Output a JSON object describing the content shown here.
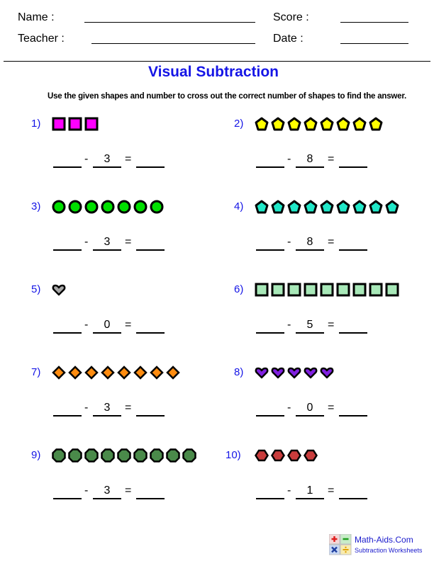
{
  "header": {
    "name_label": "Name :",
    "teacher_label": "Teacher :",
    "score_label": "Score :",
    "date_label": "Date :"
  },
  "title": "Visual Subtraction",
  "instructions": "Use the given shapes and number to cross out the correct number of shapes to find the answer.",
  "equation_symbols": {
    "minus": "-",
    "equals": "="
  },
  "problems": [
    {
      "label": "1)",
      "shape": "square",
      "count": 3,
      "fill": "#ff00ff",
      "subtract": "3"
    },
    {
      "label": "2)",
      "shape": "pentagon",
      "count": 8,
      "fill": "#ffff00",
      "subtract": "8"
    },
    {
      "label": "3)",
      "shape": "circle",
      "count": 7,
      "fill": "#00e000",
      "subtract": "3"
    },
    {
      "label": "4)",
      "shape": "pentagon",
      "count": 9,
      "fill": "#20e8c8",
      "subtract": "8"
    },
    {
      "label": "5)",
      "shape": "heart",
      "count": 1,
      "fill": "#a8a8a8",
      "subtract": "0"
    },
    {
      "label": "6)",
      "shape": "square",
      "count": 9,
      "fill": "#a8e8b8",
      "subtract": "5"
    },
    {
      "label": "7)",
      "shape": "diamond",
      "count": 8,
      "fill": "#ff8c10",
      "subtract": "3"
    },
    {
      "label": "8)",
      "shape": "heart",
      "count": 5,
      "fill": "#8020e0",
      "subtract": "0"
    },
    {
      "label": "9)",
      "shape": "octagon",
      "count": 9,
      "fill": "#4a8a4a",
      "subtract": "3"
    },
    {
      "label": "10)",
      "shape": "hexagon",
      "count": 4,
      "fill": "#c83c3c",
      "subtract": "1"
    }
  ],
  "footer": {
    "brand": "Math-Aids.Com",
    "subtitle": "Subtraction Worksheets",
    "logo_icons": [
      "plus-icon",
      "minus-icon",
      "times-icon",
      "divide-icon"
    ]
  }
}
